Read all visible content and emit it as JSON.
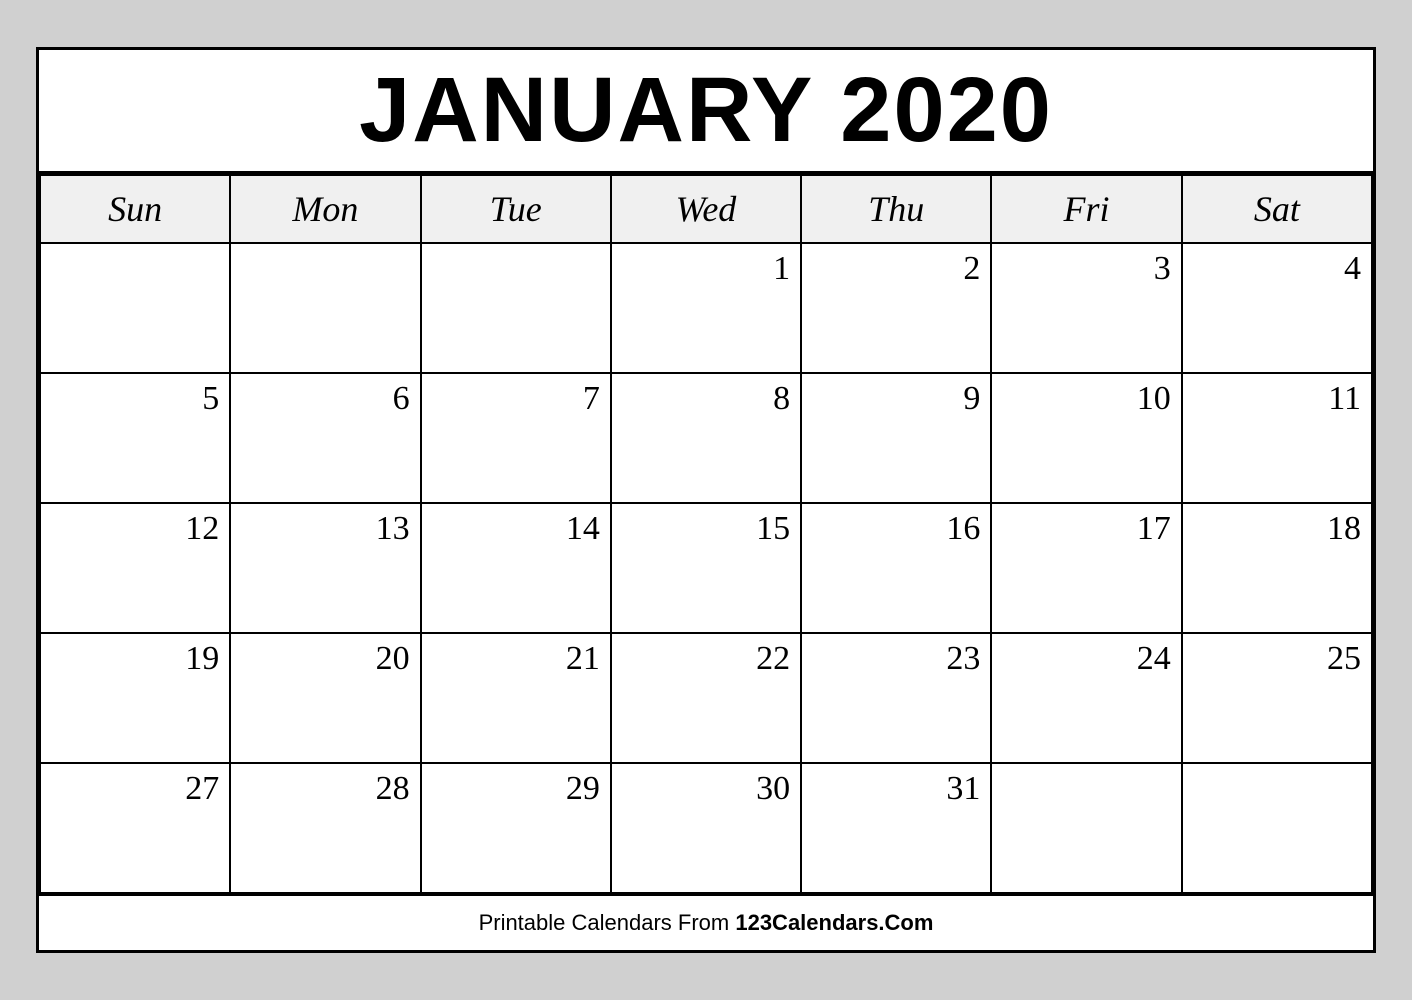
{
  "calendar": {
    "title": "JANUARY 2020",
    "days_of_week": [
      "Sun",
      "Mon",
      "Tue",
      "Wed",
      "Thu",
      "Fri",
      "Sat"
    ],
    "weeks": [
      [
        "",
        "",
        "",
        "1",
        "2",
        "3",
        "4"
      ],
      [
        "5",
        "6",
        "7",
        "8",
        "9",
        "10",
        "11"
      ],
      [
        "12",
        "13",
        "14",
        "15",
        "16",
        "17",
        "18"
      ],
      [
        "19",
        "20",
        "21",
        "22",
        "23",
        "24",
        "25"
      ],
      [
        "27",
        "28",
        "29",
        "30",
        "31",
        "",
        ""
      ]
    ]
  },
  "footer": {
    "text_before": "Printable Calendars From ",
    "site_name": "123Calendars.Com"
  }
}
